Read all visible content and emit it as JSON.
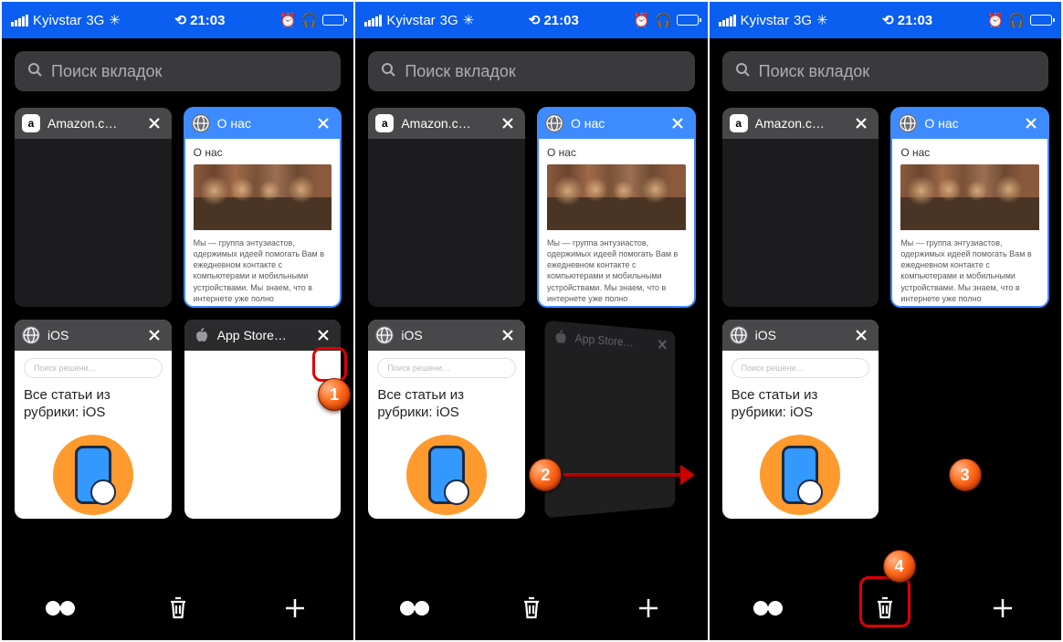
{
  "status": {
    "carrier": "Kyivstar",
    "network": "3G",
    "time": "21:03"
  },
  "search": {
    "placeholder": "Поиск вкладок"
  },
  "tabs": {
    "amazon": {
      "title": "Amazon.c…"
    },
    "onas": {
      "title": "О нас",
      "heading": "О нас",
      "body": "Мы — группа энтузиастов, одержимых идеей помогать Вам в ежедневном контакте с компьютерами и мобильными устройствами. Мы знаем, что в интернете уже полно"
    },
    "ios": {
      "title": "iOS",
      "search_placeholder": "Поиск решени…",
      "heading": "Все статьи из рубрики: iOS"
    },
    "appstore": {
      "title": "App Store…"
    }
  },
  "markers": {
    "m1": "1",
    "m2": "2",
    "m3": "3",
    "m4": "4"
  }
}
